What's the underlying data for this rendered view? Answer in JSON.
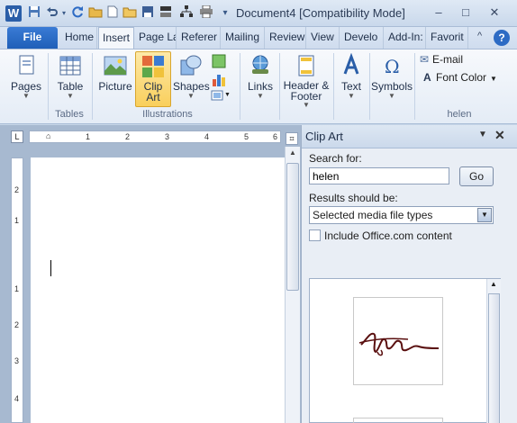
{
  "titlebar": {
    "app_letter": "W",
    "title": "Document4 [Compatibility Mode]",
    "minimize": "–",
    "maximize": "□",
    "close": "✕"
  },
  "qat": {
    "save": "💾",
    "undo": "↶",
    "redo": "↻",
    "customize": "▾"
  },
  "tabs": [
    {
      "label": "File"
    },
    {
      "label": "Home"
    },
    {
      "label": "Insert"
    },
    {
      "label": "Page La"
    },
    {
      "label": "Referer"
    },
    {
      "label": "Mailing"
    },
    {
      "label": "Review"
    },
    {
      "label": "View"
    },
    {
      "label": "Develo"
    },
    {
      "label": "Add-In:"
    },
    {
      "label": "Favorit"
    }
  ],
  "ribbon": {
    "pages": "Pages",
    "table": "Table",
    "picture": "Picture",
    "clipart_line1": "Clip",
    "clipart_line2": "Art",
    "shapes": "Shapes",
    "links": "Links",
    "header_line1": "Header &",
    "header_line2": "Footer",
    "text": "Text",
    "symbols": "Symbols",
    "email": "E-mail",
    "font_color": "Font Color",
    "groups": {
      "tables": "Tables",
      "illustrations": "Illustrations",
      "helen": "helen"
    }
  },
  "ruler": {
    "h_marks": [
      "1",
      "1",
      "2",
      "3",
      "4",
      "5",
      "6"
    ],
    "v_marks": [
      "2",
      "1",
      "1",
      "2",
      "3",
      "4"
    ]
  },
  "pane": {
    "title": "Clip Art",
    "search_label": "Search for:",
    "search_value": "helen",
    "go_label": "Go",
    "results_label": "Results should be:",
    "results_value": "Selected media file types",
    "office_label": "Include Office.com content",
    "office_checked": false
  }
}
